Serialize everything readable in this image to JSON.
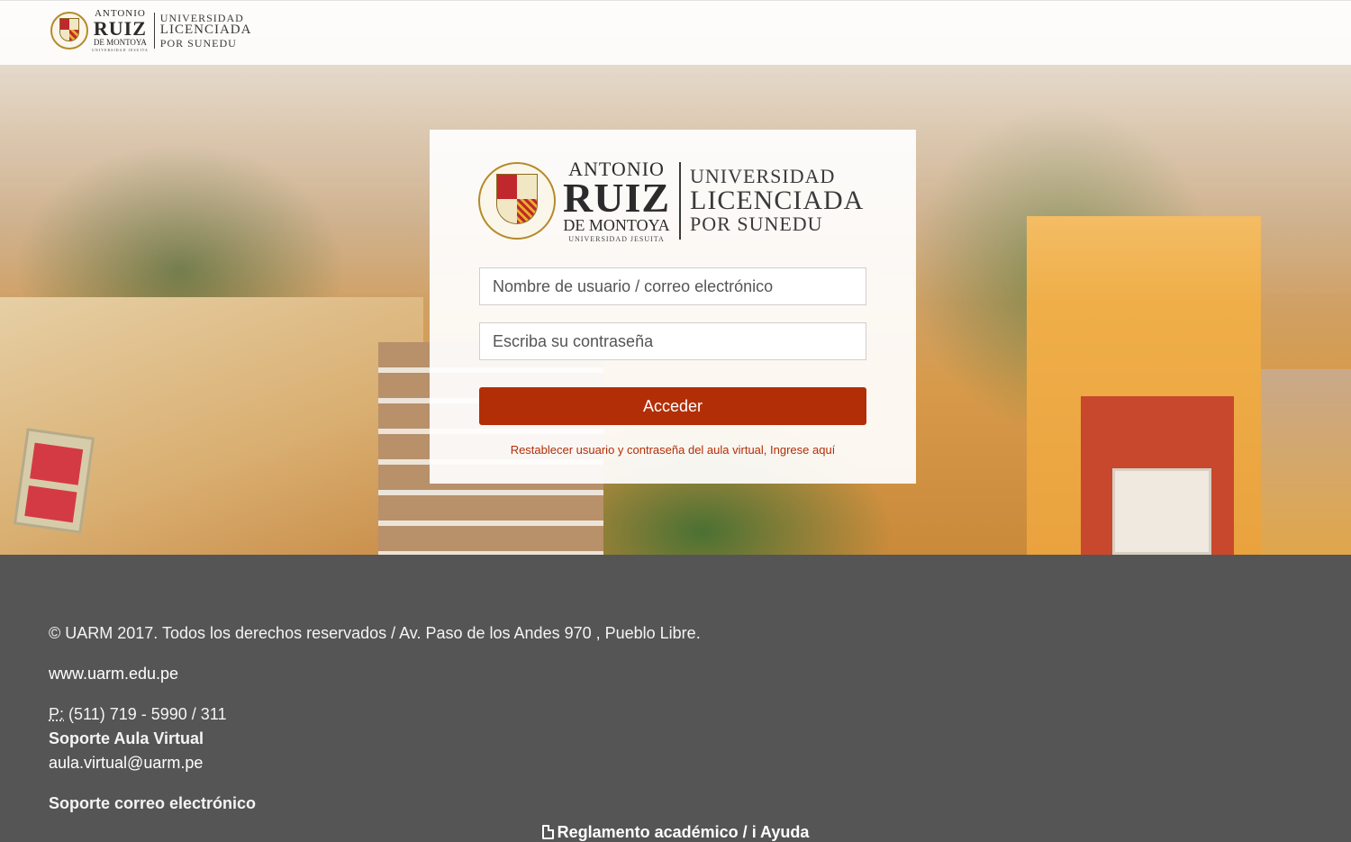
{
  "brand": {
    "crest_motto": "GLORIA DEI VIVENS HOMO",
    "crest_monogram": "UARM",
    "name_line1": "ANTONIO",
    "name_line2": "RUIZ",
    "name_line3": "DE MONTOYA",
    "name_line4": "UNIVERSIDAD JESUITA",
    "license_line1": "UNIVERSIDAD",
    "license_line2": "LICENCIADA",
    "license_line3": "POR SUNEDU"
  },
  "login": {
    "username_placeholder": "Nombre de usuario / correo electrónico",
    "password_placeholder": "Escriba su contraseña",
    "submit_label": "Acceder",
    "reset_link": "Restablecer usuario y contraseña del aula virtual, Ingrese aquí"
  },
  "footer": {
    "copyright": "© UARM 2017. Todos los derechos reservados / Av. Paso de los Andes 970 , Pueblo Libre.",
    "website": "www.uarm.edu.pe",
    "phone_label": "P:",
    "phone_number": " (511) 719 - 5990 / 311",
    "support_title": "Soporte Aula Virtual",
    "support_email": "aula.virtual@uarm.pe",
    "mail_support_title": "Soporte correo electrónico",
    "regulation_link": "Reglamento académico",
    "separator": " / ",
    "info_glyph": "i",
    "help_link": " Ayuda"
  },
  "colors": {
    "accent": "#b22e07",
    "footer_bg": "#555555",
    "crest_red": "#c0282d",
    "crest_gold": "#e8b028"
  },
  "icons": [
    "pdf-file-icon",
    "info-icon"
  ]
}
